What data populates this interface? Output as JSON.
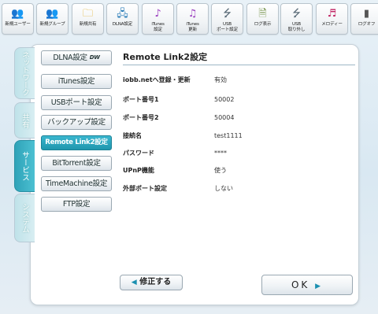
{
  "toolbar": [
    {
      "label": "新規ユーザー",
      "icon": "add-user-icon",
      "glyph": "👥"
    },
    {
      "label": "新規グループ",
      "icon": "add-group-icon",
      "glyph": "👥"
    },
    {
      "label": "新規共有",
      "icon": "new-share-folder-icon",
      "glyph": "🗀"
    },
    {
      "label": "DLNA設定",
      "icon": "dlna-network-icon",
      "glyph": "🖧"
    },
    {
      "label": "iTunes\n設定",
      "icon": "itunes-note-icon",
      "glyph": "♪"
    },
    {
      "label": "iTunes\n更新",
      "icon": "itunes-update-icon",
      "glyph": "♫"
    },
    {
      "label": "USB\nポート設定",
      "icon": "usb-icon",
      "glyph": "⭍"
    },
    {
      "label": "ログ表示",
      "icon": "log-document-icon",
      "glyph": "🗎"
    },
    {
      "label": "USB\n取り外し",
      "icon": "usb-remove-icon",
      "glyph": "⭍"
    },
    {
      "label": "メロディー",
      "icon": "melody-icon",
      "glyph": "♬"
    },
    {
      "label": "ログオフ",
      "icon": "logoff-door-icon",
      "glyph": "▮"
    }
  ],
  "side_tabs": [
    {
      "label": "ネットワーク",
      "active": false
    },
    {
      "label": "共有",
      "active": false
    },
    {
      "label": "サービス",
      "active": true
    },
    {
      "label": "システム",
      "active": false
    }
  ],
  "menu": [
    {
      "label": "DLNA設定",
      "logo": "DW",
      "selected": false
    },
    {
      "label": "iTunes設定",
      "selected": false
    },
    {
      "label": "USBポート設定",
      "selected": false
    },
    {
      "label": "バックアップ設定",
      "selected": false
    },
    {
      "label": "Remote Link2設定",
      "selected": true
    },
    {
      "label": "BitTorrent設定",
      "selected": false
    },
    {
      "label": "TimeMachine設定",
      "selected": false
    },
    {
      "label": "FTP設定",
      "selected": false
    }
  ],
  "content": {
    "title": "Remote Link2設定",
    "rows": [
      {
        "label": "iobb.netへ登録・更新",
        "value": "有効"
      },
      {
        "label": "ポート番号1",
        "value": "50002"
      },
      {
        "label": "ポート番号2",
        "value": "50004"
      },
      {
        "label": "接続名",
        "value": "test1111"
      },
      {
        "label": "パスワード",
        "value": "****"
      },
      {
        "label": "UPnP機能",
        "value": "使う"
      },
      {
        "label": "外部ポート設定",
        "value": "しない"
      }
    ]
  },
  "buttons": {
    "back_label": "修正する",
    "back_arrow": "◀",
    "ok_label": "OK",
    "ok_arrow": "▶"
  },
  "colors": {
    "accent": "#1f96ad",
    "active_tab": "#2fa3b8"
  }
}
